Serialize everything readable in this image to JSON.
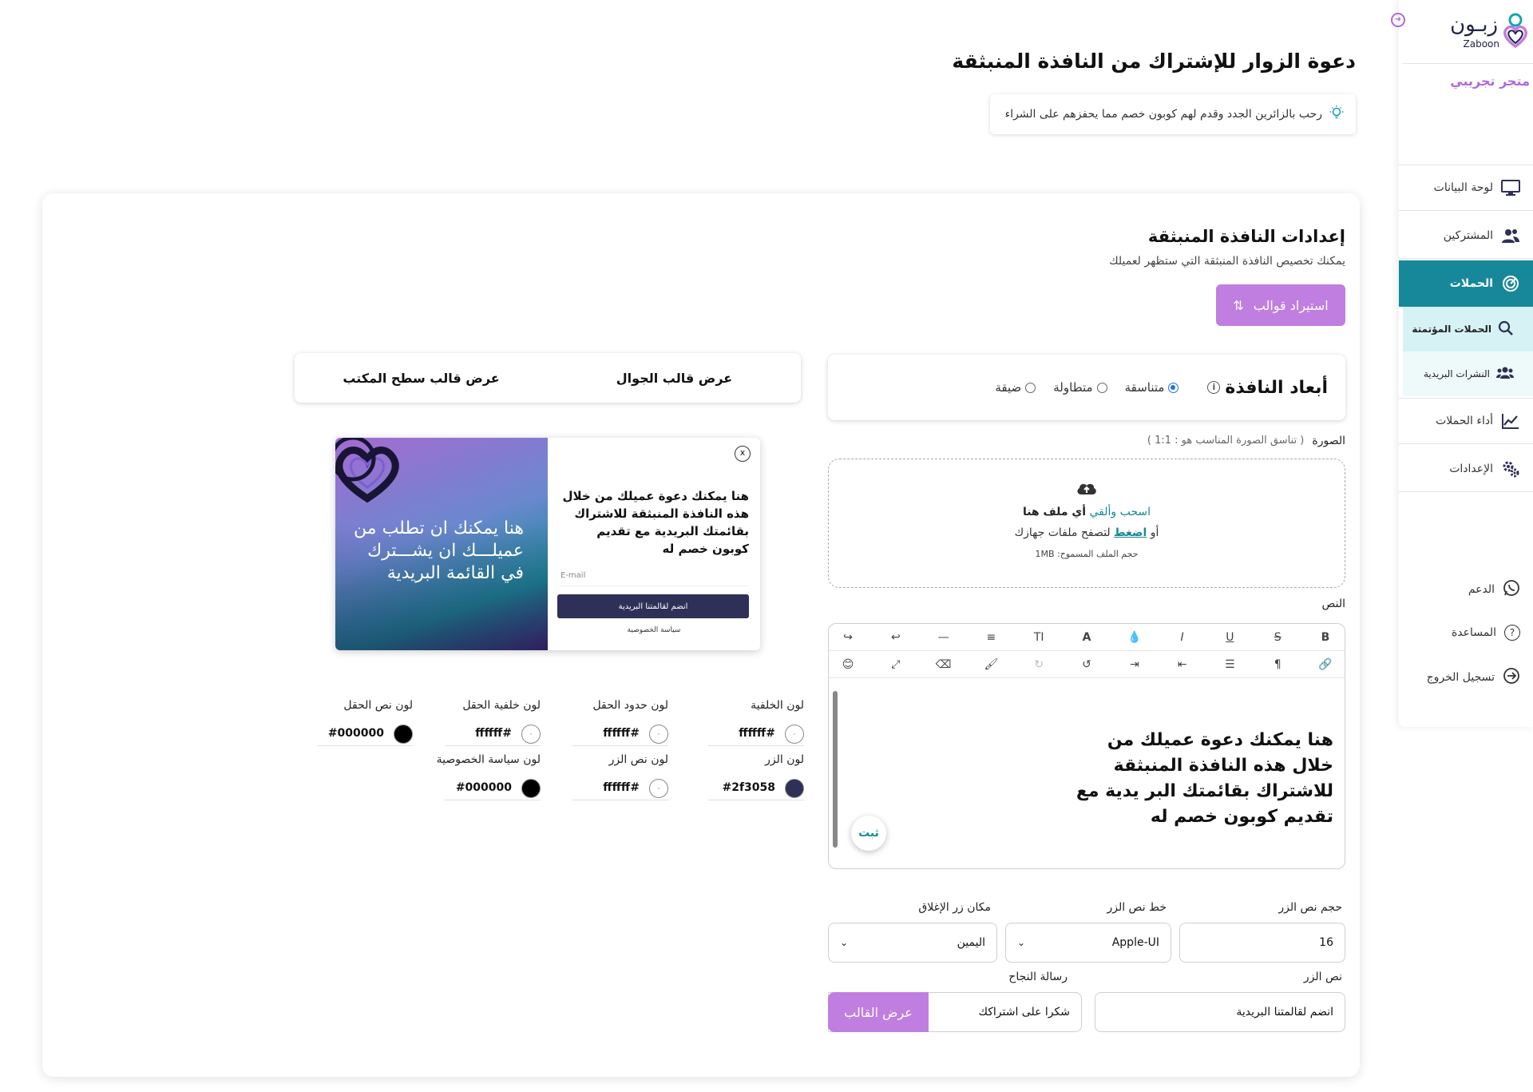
{
  "sidebar": {
    "logo_text": "زبـون",
    "logo_sub": "Zaboon",
    "store_name": "متجر تجريبي",
    "items": [
      {
        "label": "لوحة البيانات",
        "icon": "monitor-icon"
      },
      {
        "label": "المشتركين",
        "icon": "users-icon"
      },
      {
        "label": "الحملات",
        "icon": "campaign-icon"
      },
      {
        "label": "أداء الحملات",
        "icon": "chart-line-icon"
      },
      {
        "label": "الإعدادات",
        "icon": "gears-icon"
      }
    ],
    "sub_items": [
      {
        "label": "الحملات المؤتمتة",
        "icon": "search-icon"
      },
      {
        "label": "النشرات البريدية",
        "icon": "group-icon"
      }
    ],
    "bottom": [
      {
        "label": "الدعم",
        "icon": "whatsapp-icon"
      },
      {
        "label": "المساعدة",
        "icon": "help-icon"
      },
      {
        "label": "تسجيل الخروج",
        "icon": "logout-icon"
      }
    ]
  },
  "header": {
    "title": "دعوة الزوار للإشتراك من النافذة المنبثقة",
    "tip": "رحب بالزائرين الجدد وقدم لهم كوبون خصم مما يحفزهم على الشراء"
  },
  "settings": {
    "title": "إعدادات النافذة المنبثقة",
    "subtitle": "يمكنك تخصيص النافذة المنبثقة التي ستظهر لعميلك",
    "import_label": "استيراد قوالب"
  },
  "dimensions": {
    "title": "أبعاد النافذة",
    "options": [
      {
        "label": "متناسقة",
        "selected": true
      },
      {
        "label": "متطاولة",
        "selected": false
      },
      {
        "label": "ضيقة",
        "selected": false
      }
    ]
  },
  "view_toggle": {
    "mobile": "عرض قالب الجوال",
    "desktop": "عرض قالب سطح المكتب"
  },
  "image": {
    "label": "الصورة",
    "hint": "( تناسق الصورة المناسب هو : 1:1 )",
    "drag": "اسحب وألقي",
    "anyfile": "أي ملف هنا",
    "or": "أو",
    "click": "اضغط",
    "browse": "لتصفح ملفات جهازك",
    "size": "حجم الملف المسموح: 1MB"
  },
  "editor": {
    "label": "النص",
    "content": "هنا يمكنك دعوة عميلك من خلال هذه النافذة المنبثقة للاشتراك بقائمتك البر يدية مع تقديم كوبون خصم له",
    "fix_label": "ثبت",
    "toolbar_row1": [
      "B",
      "S",
      "U",
      "I",
      "💧",
      "A",
      "TI",
      "≡",
      "—",
      "↩",
      "↪"
    ],
    "toolbar_row2": [
      "🔗",
      "¶",
      "☰",
      "⇤",
      "⇥",
      "↺",
      "↻",
      "🖌",
      "⌫",
      "⤢",
      "😊"
    ]
  },
  "form": {
    "font_size_label": "حجم نص الزر",
    "font_size_value": "16",
    "font_label": "خط نص الزر",
    "font_value": "Apple-UI",
    "close_pos_label": "مكان زر الإغلاق",
    "close_pos_value": "اليمين",
    "btn_text_label": "نص الزر",
    "btn_text_value": "انضم لقالمتنا البريدية",
    "success_label": "رسالة النجاح",
    "success_value": "شكرا على اشتراكك",
    "preview_label": "عرض القالب"
  },
  "popup": {
    "close": "x",
    "image_text": "هنا يمكنك ان تطلب من عميلـــك ان يشـــترك في القائمة البريدية",
    "text": "هنا يمكنك دعوة عميلك من خلال هذه النافذة المنبثقة للاشتراك بقائمتك البريدية مع تقديم كوبون خصم له",
    "email_placeholder": "E-mail",
    "join": "انضم لقالمتنا البريدية",
    "policy": "سياسة الخصوصية"
  },
  "colors": [
    {
      "label": "لون الخلفية",
      "hex": "ffffff#",
      "swatch": "#ffffff"
    },
    {
      "label": "لون حدود الحقل",
      "hex": "ffffff#",
      "swatch": "#ffffff"
    },
    {
      "label": "لون خلفية الحقل",
      "hex": "ffffff#",
      "swatch": "#ffffff"
    },
    {
      "label": "لون نص الحقل",
      "hex": "#000000",
      "swatch": "#000000"
    },
    {
      "label": "لون الزر",
      "hex": "#2f3058",
      "swatch": "#2f3058"
    },
    {
      "label": "لون نص الزر",
      "hex": "ffffff#",
      "swatch": "#ffffff"
    },
    {
      "label": "لون سياسة الخصوصية",
      "hex": "#000000",
      "swatch": "#000000"
    }
  ],
  "theme": {
    "primary": "#17889a",
    "accent": "#c07ee0",
    "button": "#2f3058"
  }
}
